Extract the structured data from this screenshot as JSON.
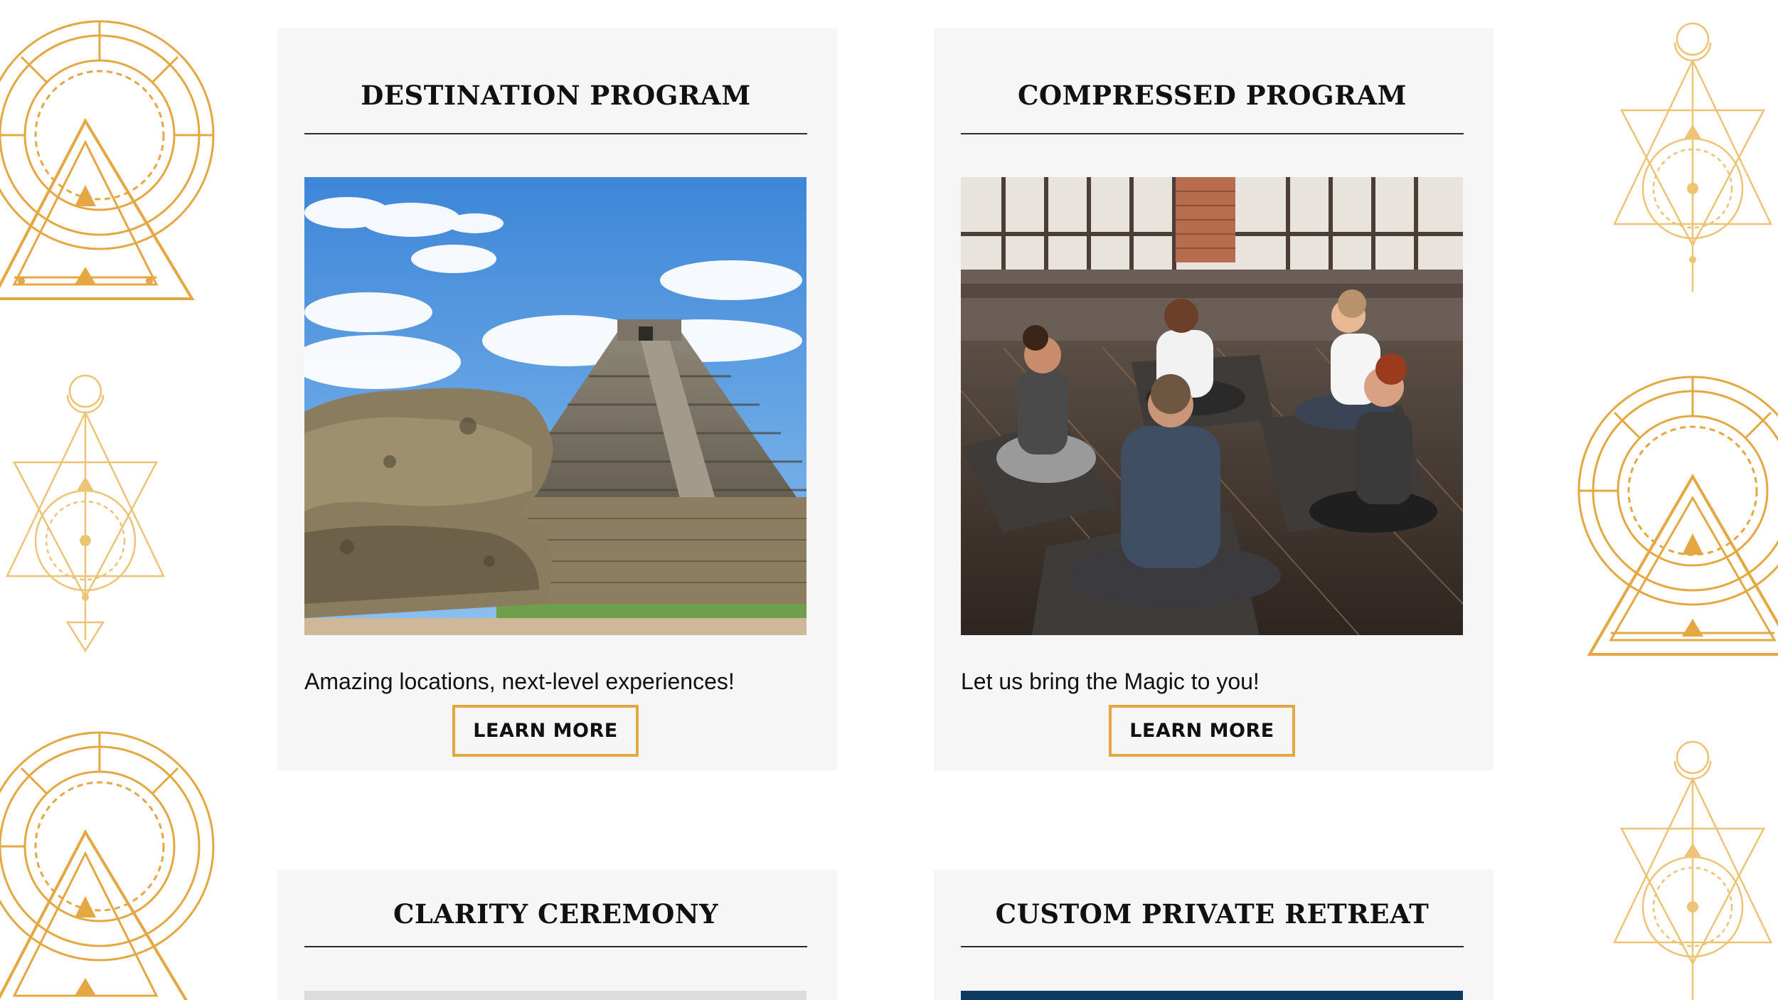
{
  "cards": [
    {
      "title": "DESTINATION PROGRAM",
      "description": "Amazing locations, next-level experiences!",
      "button_label": "LEARN MORE",
      "image_alt": "pyramid-photo"
    },
    {
      "title": "COMPRESSED PROGRAM",
      "description": "Let us bring the Magic to you!",
      "button_label": "LEARN MORE",
      "image_alt": "yoga-circle-photo"
    },
    {
      "title": "CLARITY CEREMONY"
    },
    {
      "title": "CUSTOM PRIVATE RETREAT"
    }
  ],
  "colors": {
    "accent": "#e5a742",
    "card_bg": "#f6f6f6",
    "page_bg": "#ffffff",
    "bottom_image_dark": "#0d3a63"
  },
  "icons": [
    "sacred-geometry-circle-icon",
    "sacred-geometry-triangle-icon"
  ]
}
